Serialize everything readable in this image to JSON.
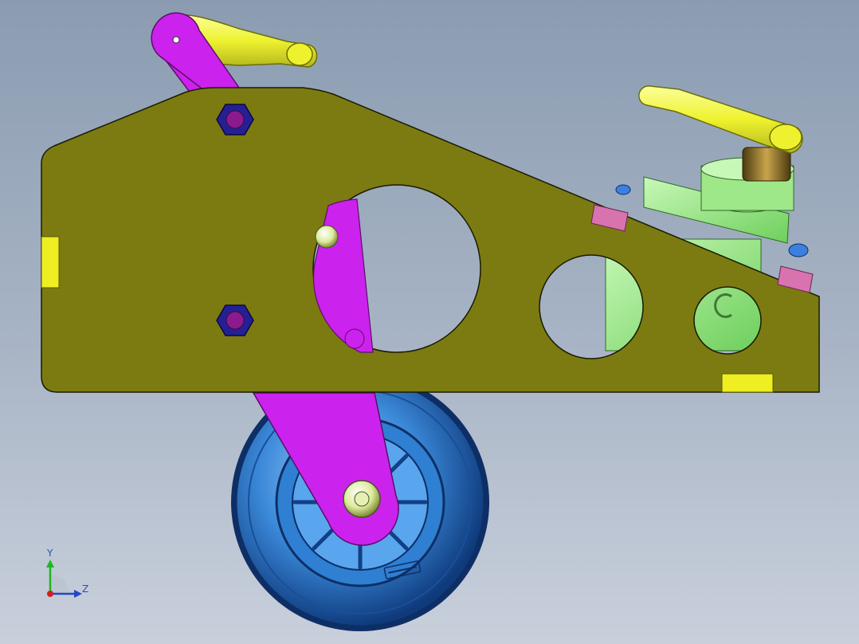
{
  "viewport": {
    "background_top": "#8b9cb1",
    "background_bottom": "#c9d0dc"
  },
  "colors": {
    "plate": "#7b7b12",
    "arm": "#cc22ee",
    "handle": "#eef22e",
    "pad": "#eeee22",
    "wheel": "#3a88d8",
    "wheel_dark": "#0d2f66",
    "nut": "#242094",
    "pin": "#dceb9a",
    "clamp_body": "#8ee07a",
    "pink_block": "#d873b0"
  },
  "triad": {
    "y_label": "Y",
    "z_label": "Z"
  }
}
